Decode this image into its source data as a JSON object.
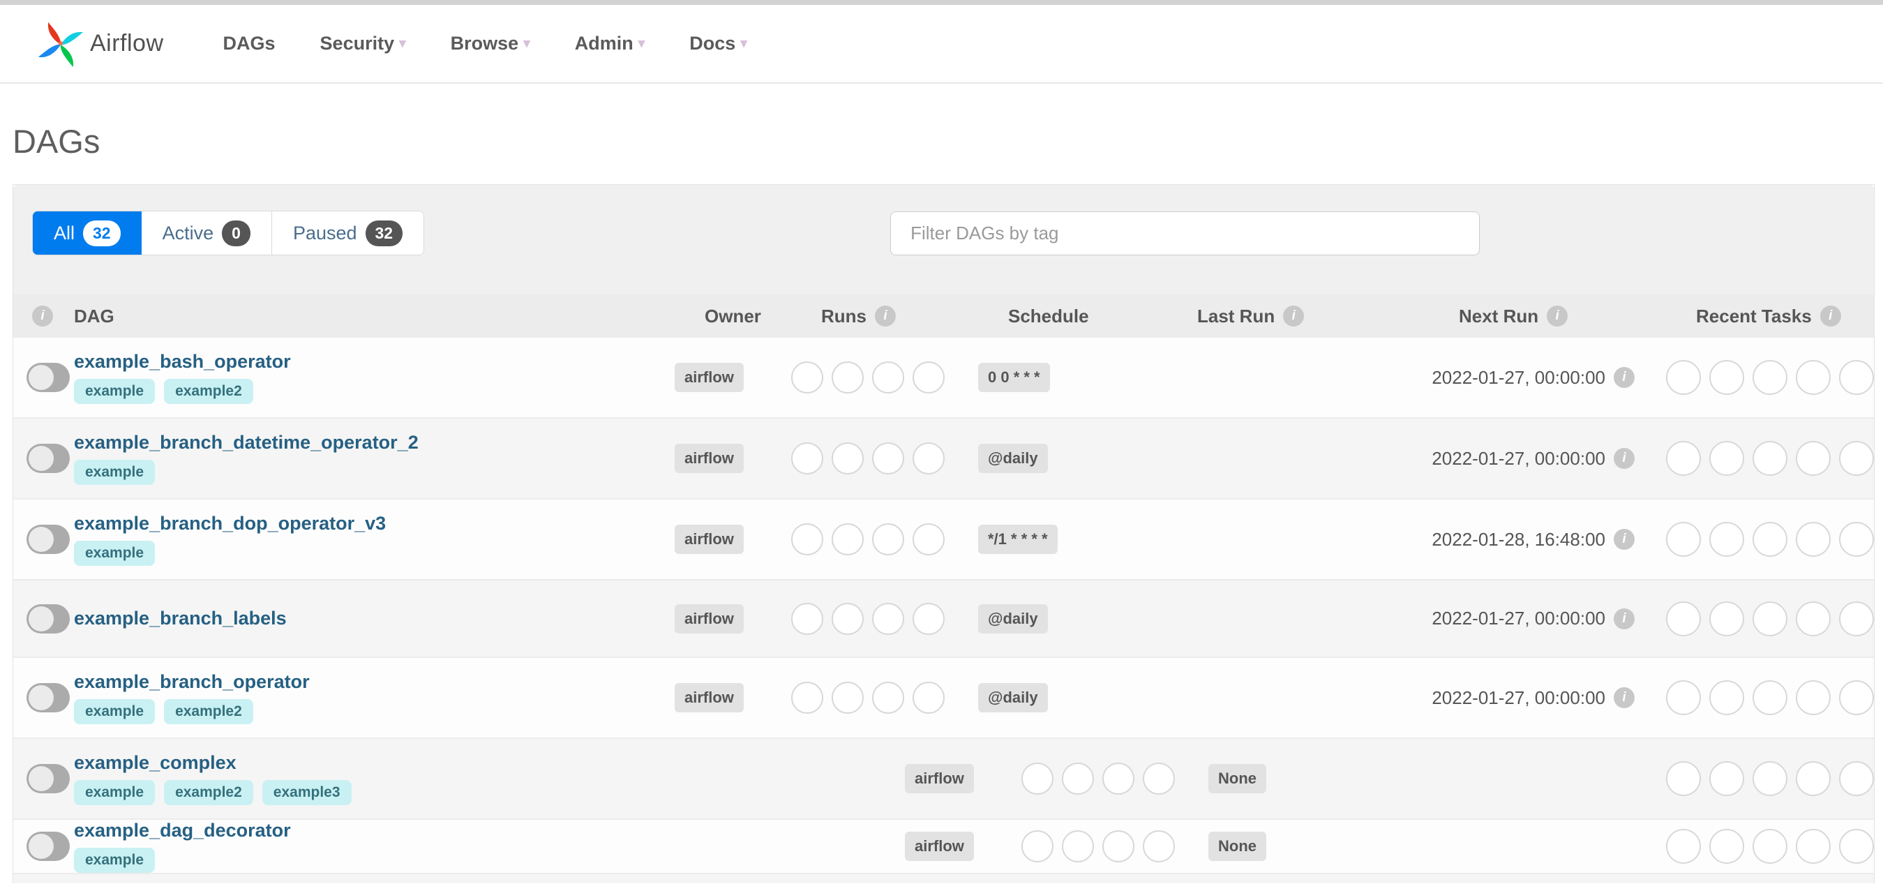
{
  "glyphs": {
    "info": "i",
    "caret": "▾"
  },
  "colors": {
    "accent": "#017cee",
    "tag_bg": "#c9f1f3",
    "tag_text": "#35707c",
    "link": "#266083"
  },
  "nav": {
    "brand": "Airflow",
    "items": [
      {
        "label": "DAGs",
        "caret": false
      },
      {
        "label": "Security",
        "caret": true
      },
      {
        "label": "Browse",
        "caret": true
      },
      {
        "label": "Admin",
        "caret": true
      },
      {
        "label": "Docs",
        "caret": true
      }
    ]
  },
  "page": {
    "title": "DAGs"
  },
  "filters": {
    "tabs": [
      {
        "label": "All",
        "count": "32",
        "active": true
      },
      {
        "label": "Active",
        "count": "0",
        "active": false
      },
      {
        "label": "Paused",
        "count": "32",
        "active": false
      }
    ],
    "search_placeholder": "Filter DAGs by tag"
  },
  "table": {
    "headers": {
      "dag": "DAG",
      "owner": "Owner",
      "runs": "Runs",
      "schedule": "Schedule",
      "last_run": "Last Run",
      "next_run": "Next Run",
      "recent_tasks": "Recent Tasks"
    },
    "rows": [
      {
        "name": "example_bash_operator",
        "tags": [
          "example",
          "example2"
        ],
        "owner": "airflow",
        "schedule": "0 0 * * *",
        "last_run": "",
        "next_run": "2022-01-27, 00:00:00"
      },
      {
        "name": "example_branch_datetime_operator_2",
        "tags": [
          "example"
        ],
        "owner": "airflow",
        "schedule": "@daily",
        "last_run": "",
        "next_run": "2022-01-27, 00:00:00"
      },
      {
        "name": "example_branch_dop_operator_v3",
        "tags": [
          "example"
        ],
        "owner": "airflow",
        "schedule": "*/1 * * * *",
        "last_run": "",
        "next_run": "2022-01-28, 16:48:00"
      },
      {
        "name": "example_branch_labels",
        "tags": [],
        "owner": "airflow",
        "schedule": "@daily",
        "last_run": "",
        "next_run": "2022-01-27, 00:00:00"
      },
      {
        "name": "example_branch_operator",
        "tags": [
          "example",
          "example2"
        ],
        "owner": "airflow",
        "schedule": "@daily",
        "last_run": "",
        "next_run": "2022-01-27, 00:00:00"
      },
      {
        "name": "example_complex",
        "tags": [
          "example",
          "example2",
          "example3"
        ],
        "owner": "airflow",
        "schedule": "None",
        "last_run": "",
        "next_run": ""
      },
      {
        "name": "example_dag_decorator",
        "tags": [
          "example"
        ],
        "owner": "airflow",
        "schedule": "None",
        "last_run": "",
        "next_run": ""
      }
    ]
  }
}
